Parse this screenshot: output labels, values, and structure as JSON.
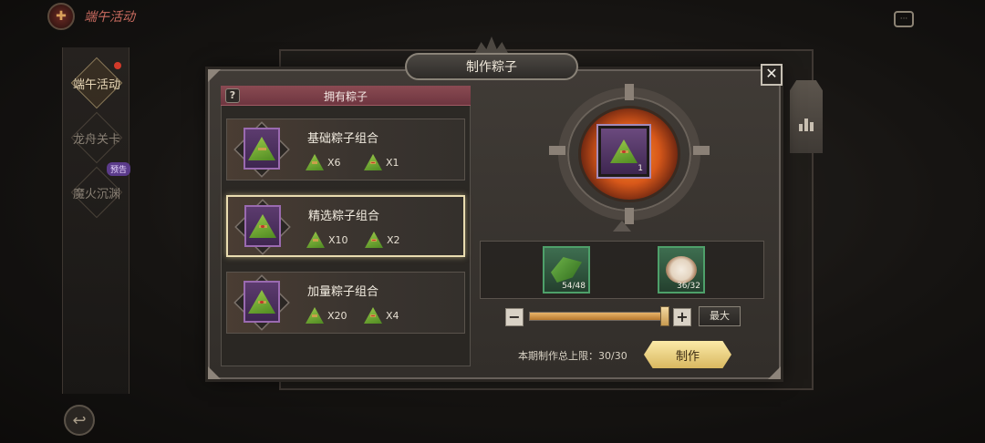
{
  "sidebar": {
    "top_title": "端午活动",
    "items": [
      {
        "label": "端午活动",
        "active": true,
        "has_dot": true
      },
      {
        "label": "龙舟关卡",
        "active": false
      },
      {
        "label": "魔火沉渊",
        "active": false,
        "badge": "预告"
      }
    ]
  },
  "dialog": {
    "title": "制作粽子",
    "close_label": "✕"
  },
  "list": {
    "header": "拥有粽子",
    "help_label": "?",
    "rows": [
      {
        "name": "基础粽子组合",
        "cost1": "X6",
        "cost2": "X1",
        "selected": false
      },
      {
        "name": "精选粽子组合",
        "cost1": "X10",
        "cost2": "X2",
        "selected": true
      },
      {
        "name": "加量粽子组合",
        "cost1": "X20",
        "cost2": "X4",
        "selected": false
      }
    ]
  },
  "craft": {
    "center_qty": "1",
    "materials": [
      {
        "icon": "leaf-icon",
        "qty": "54/48"
      },
      {
        "icon": "rice-bowl-icon",
        "qty": "36/32"
      }
    ],
    "slider": {
      "minus_label": "−",
      "plus_label": "+",
      "max_label": "最大",
      "fraction": 1.0
    },
    "limit_text": "本期制作总上限：30/30",
    "craft_label": "制作"
  },
  "colors": {
    "accent": "#e8b46a",
    "selected_border": "#e9dcb0",
    "header": "#8a4a52"
  }
}
